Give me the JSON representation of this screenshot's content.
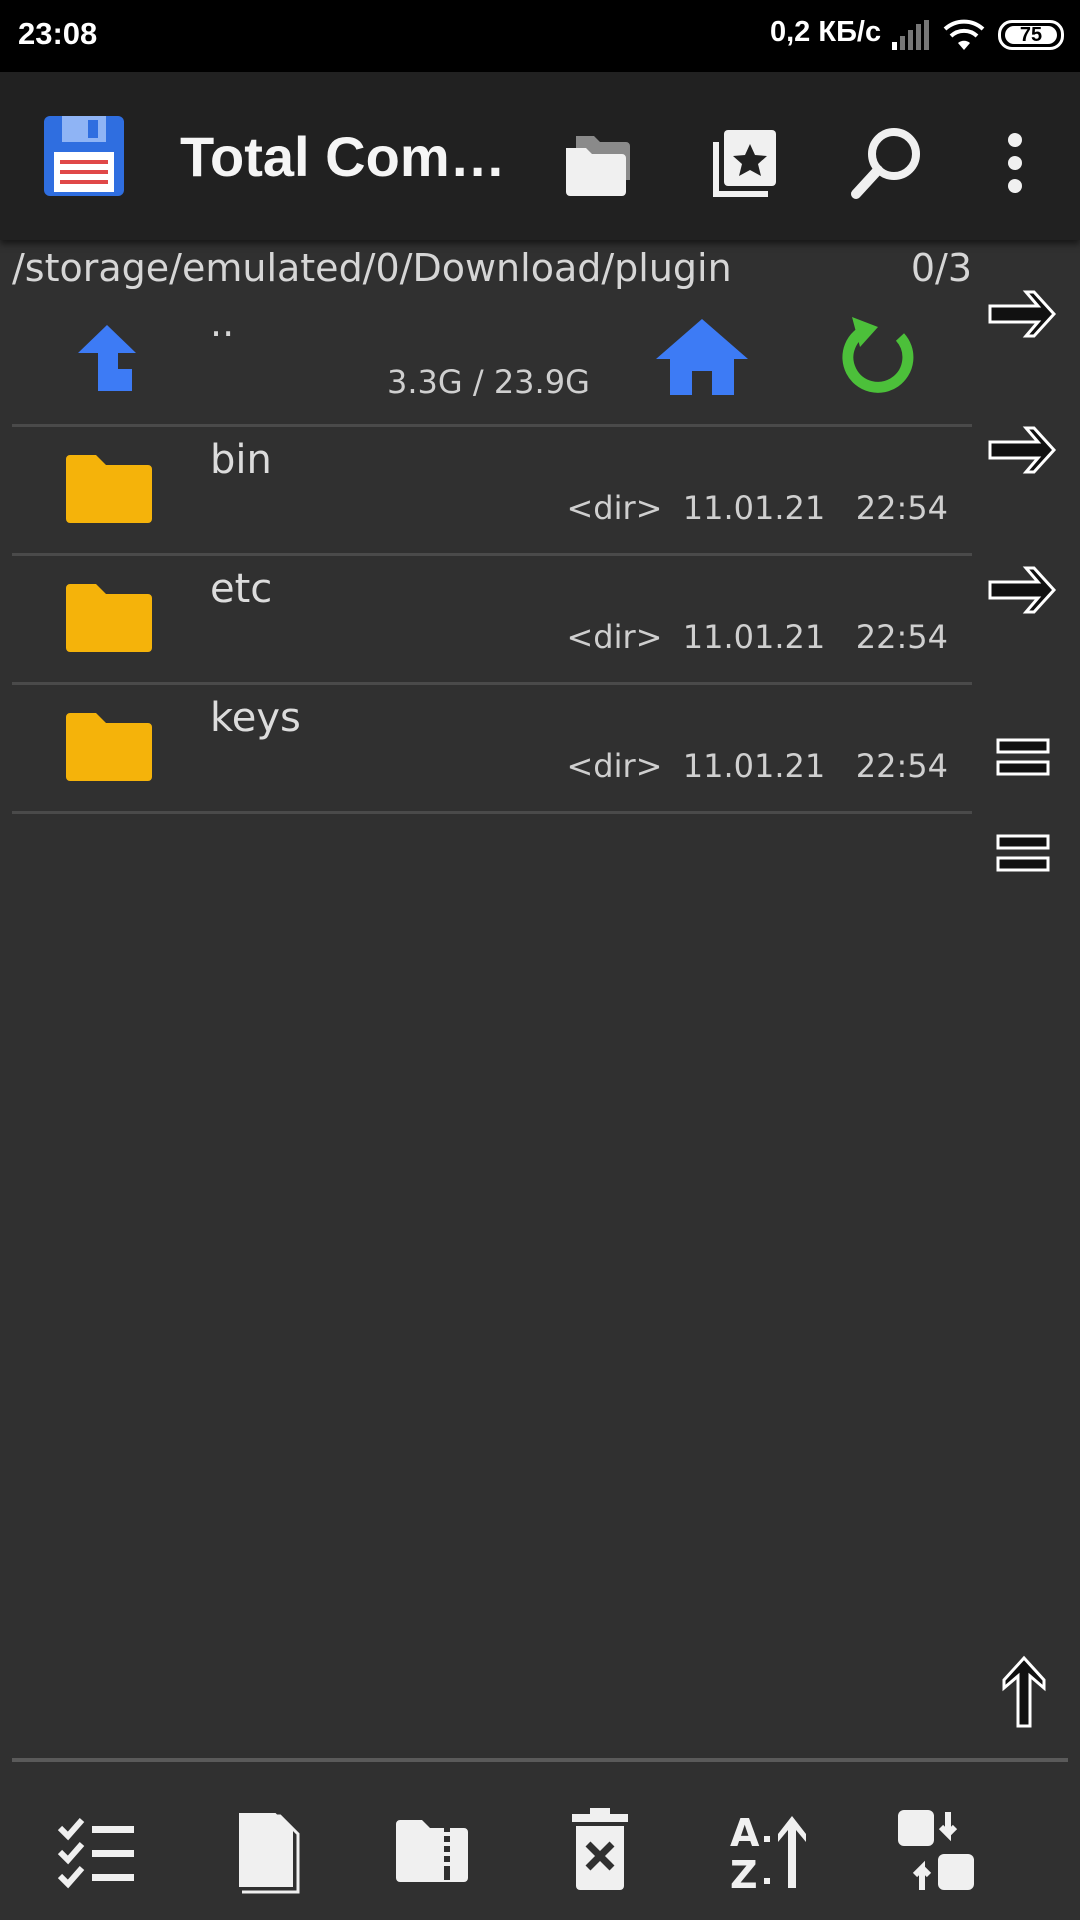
{
  "status_bar": {
    "time": "23:08",
    "speed": "0,2 КБ/с",
    "battery": "75"
  },
  "toolbar": {
    "title": "Total Com…",
    "icons": [
      "floppy-disk-icon",
      "folders-icon",
      "bookmarks-star-icon",
      "search-icon",
      "more-vert-icon"
    ]
  },
  "panel": {
    "path": "/storage/emulated/0/Download/plugin",
    "count": "0/3",
    "parent_label": "..",
    "space": "3.3G / 23.9G"
  },
  "files": [
    {
      "name": "bin",
      "meta": "<dir>  11.01.21   22:54"
    },
    {
      "name": "etc",
      "meta": "<dir>  11.01.21   22:54"
    },
    {
      "name": "keys",
      "meta": "<dir>  11.01.21   22:54"
    }
  ],
  "colors": {
    "background": "#303030",
    "toolbar": "#212121",
    "folder": "#f5b30a",
    "blue_icon": "#3d7bf5",
    "green_refresh": "#4cc03a"
  }
}
